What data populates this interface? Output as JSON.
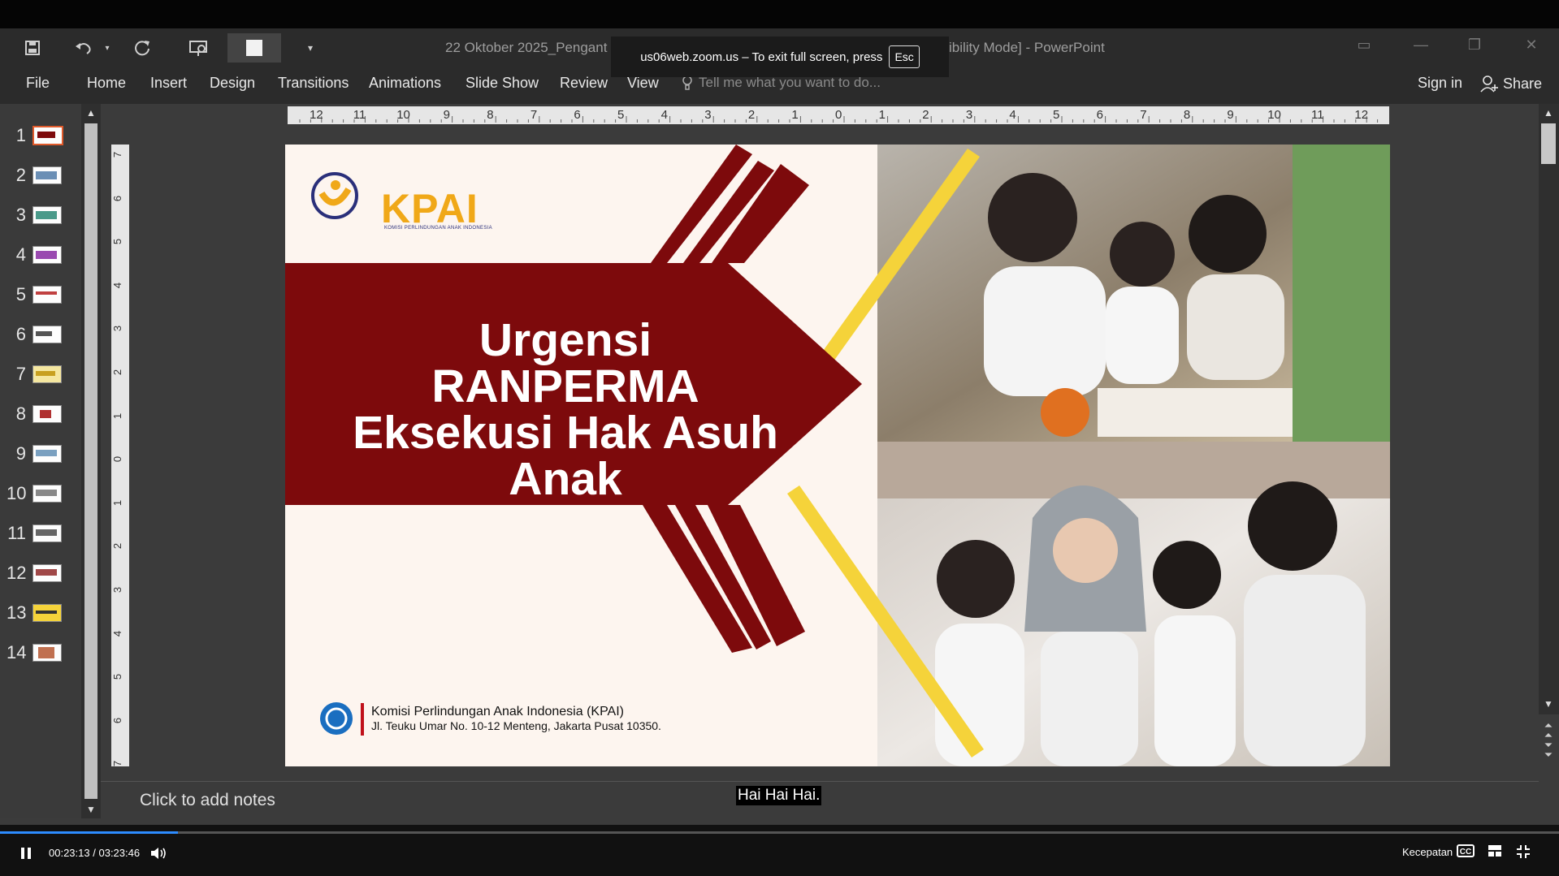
{
  "window": {
    "title_left": "22 Oktober 2025_Pengant",
    "title_right": "ibility Mode] - PowerPoint"
  },
  "zoom_notice": {
    "text": "us06web.zoom.us – To exit full screen, press",
    "key": "Esc"
  },
  "ribbon": {
    "tabs": [
      "File",
      "Home",
      "Insert",
      "Design",
      "Transitions",
      "Animations",
      "Slide Show",
      "Review",
      "View"
    ],
    "tell_me_placeholder": "Tell me what you want to do...",
    "sign_in": "Sign in",
    "share": "Share"
  },
  "thumbnails": [
    "1",
    "2",
    "3",
    "4",
    "5",
    "6",
    "7",
    "8",
    "9",
    "10",
    "11",
    "12",
    "13",
    "14"
  ],
  "ruler": {
    "horizontal": [
      "12",
      "11",
      "10",
      "9",
      "8",
      "7",
      "6",
      "5",
      "4",
      "3",
      "2",
      "1",
      "0",
      "1",
      "2",
      "3",
      "4",
      "5",
      "6",
      "7",
      "8",
      "9",
      "10",
      "11",
      "12"
    ],
    "vertical": [
      "7",
      "6",
      "5",
      "4",
      "3",
      "2",
      "1",
      "0",
      "1",
      "2",
      "3",
      "4",
      "5",
      "6",
      "7"
    ]
  },
  "slide": {
    "logo_text": "KPAI",
    "logo_subtitle": "KOMISI PERLINDUNGAN ANAK INDONESIA",
    "title_lines": [
      "Urgensi",
      "RANPERMA",
      "Eksekusi Hak Asuh",
      "Anak"
    ],
    "footer_org": "Komisi Perlindungan Anak Indonesia (KPAI)",
    "footer_address": "Jl. Teuku Umar No. 10-12 Menteng, Jakarta Pusat 10350.",
    "colors": {
      "maroon": "#7d0a0c",
      "yellow": "#f5d33a",
      "logo_orange": "#f0a818",
      "logo_blue": "#2a2f7a"
    }
  },
  "notes": {
    "placeholder": "Click to add notes"
  },
  "caption": "Hai Hai Hai.",
  "player": {
    "current_time": "00:23:13",
    "separator": "/",
    "total_time": "03:23:46",
    "speed_label": "Kecepatan",
    "progress": 0.114
  }
}
